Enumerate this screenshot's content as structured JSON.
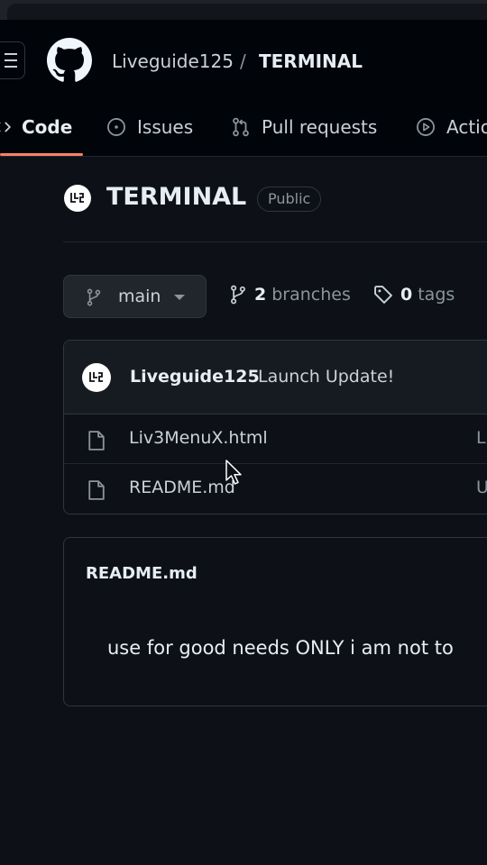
{
  "header": {
    "owner": "Liveguide125",
    "separator": "/",
    "repo": "TERMINAL"
  },
  "nav": {
    "tabs": [
      {
        "label": "Code",
        "icon": "code-icon",
        "selected": true
      },
      {
        "label": "Issues",
        "icon": "issue-opened-icon"
      },
      {
        "label": "Pull requests",
        "icon": "git-pull-request-icon"
      },
      {
        "label": "Actions",
        "icon": "play-icon"
      }
    ]
  },
  "repo": {
    "name": "TERMINAL",
    "visibility": "Public"
  },
  "branch": {
    "current": "main",
    "branches_count": "2",
    "branches_label": "branches",
    "tags_count": "0",
    "tags_label": "tags"
  },
  "commit": {
    "author": "Liveguide125",
    "message": "Launch Update!"
  },
  "files": [
    {
      "name": "Liv3MenuX.html",
      "commit_prefix": "L",
      "icon": "file-icon"
    },
    {
      "name": "README.md",
      "commit_prefix": "U",
      "icon": "file-icon"
    }
  ],
  "readme": {
    "title": "README.md",
    "text": "use for good needs ONLY i am not to"
  },
  "colors": {
    "background": "#0d1117",
    "header_bg": "#010409",
    "accent_underline": "#f78166",
    "border": "#30363d",
    "text": "#c9d1d9",
    "muted": "#8b949e"
  }
}
